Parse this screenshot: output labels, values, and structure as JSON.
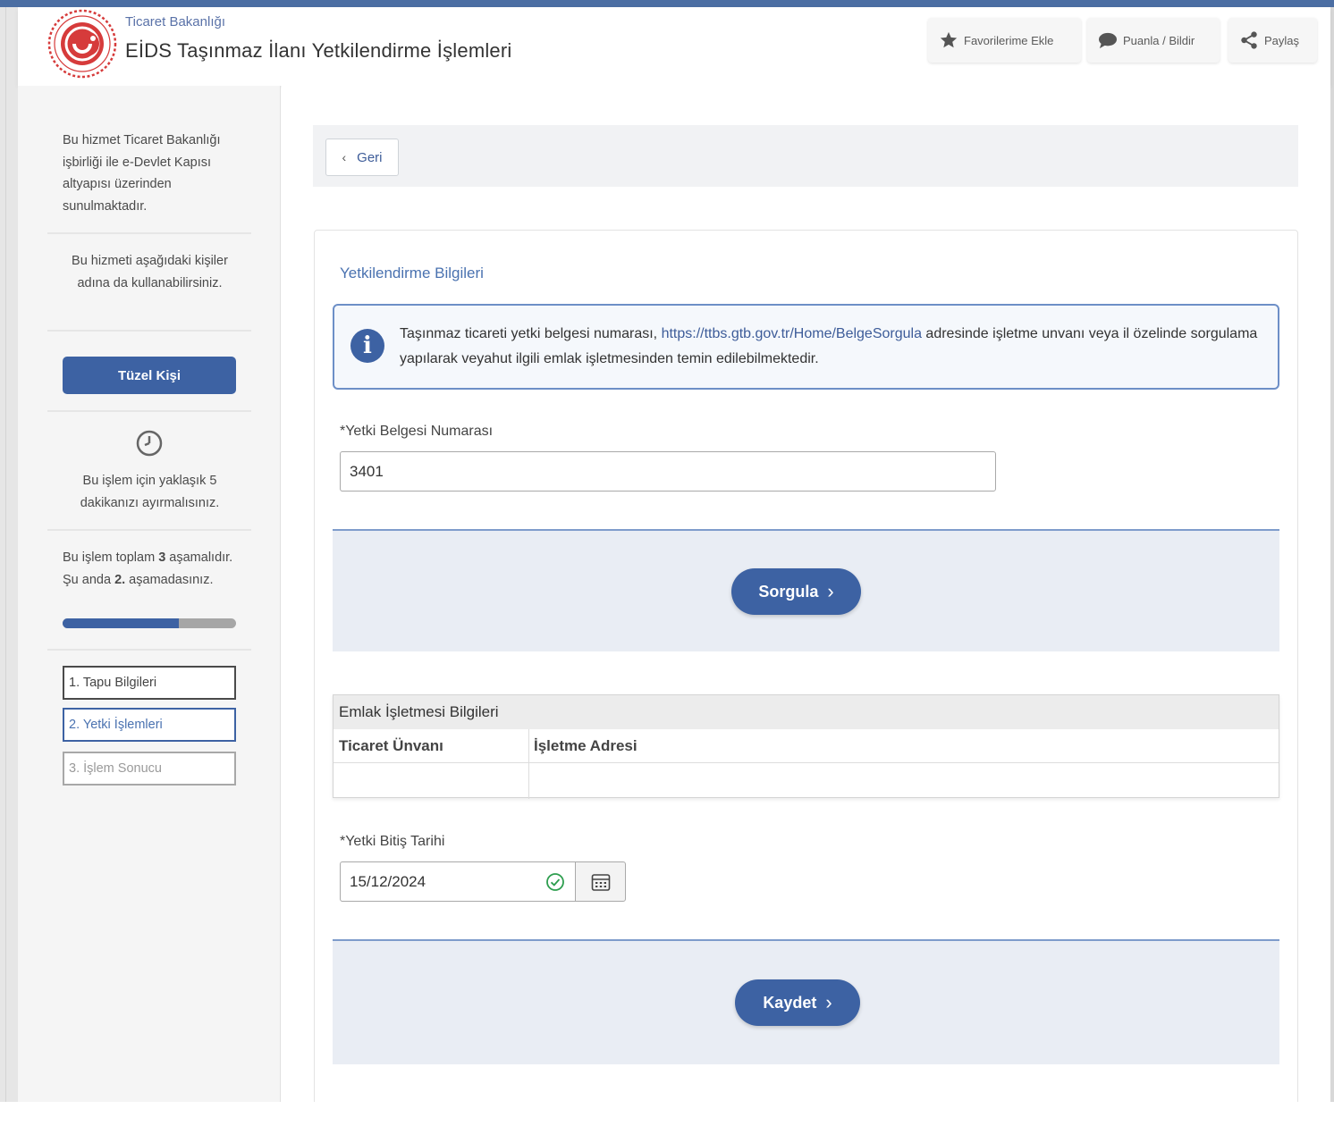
{
  "header": {
    "ministry": "Ticaret Bakanlığı",
    "title": "EİDS Taşınmaz İlanı Yetkilendirme İşlemleri",
    "favorites_label": "Favorilerime Ekle",
    "rate_label": "Puanla / Bildir",
    "share_label": "Paylaş"
  },
  "sidebar": {
    "provider_text": "Bu hizmet Ticaret Bakanlığı işbirliği ile e-Devlet Kapısı altyapısı üzerinden sunulmaktadır.",
    "proxy_text": "Bu hizmeti aşağıdaki kişiler adına da kullanabilirsiniz.",
    "tuzel_button": "Tüzel Kişi",
    "time_text": "Bu işlem için yaklaşık 5 dakikanızı ayırmalısınız.",
    "stage_prefix": "Bu işlem toplam ",
    "stage_total": "3",
    "stage_middle": " aşamalıdır. Şu anda ",
    "stage_current": "2.",
    "stage_suffix": " aşamadasınız.",
    "progress_fraction": 0.67,
    "steps": [
      {
        "label": "1. Tapu Bilgileri"
      },
      {
        "label": "2. Yetki İşlemleri"
      },
      {
        "label": "3. İşlem Sonucu"
      }
    ]
  },
  "main": {
    "back_label": "Geri",
    "section_title": "Yetkilendirme Bilgileri",
    "info_before": "Taşınmaz ticareti yetki belgesi numarası, ",
    "info_link": "https://ttbs.gtb.gov.tr/Home/BelgeSorgula",
    "info_after": " adresinde işletme unvanı veya il özelinde sorgulama yapılarak veyahut ilgili emlak işletmesinden temin edilebilmektedir.",
    "license_label": "*Yetki Belgesi Numarası",
    "license_value": "3401",
    "query_button": "Sorgula",
    "table": {
      "caption": "Emlak İşletmesi Bilgileri",
      "columns": [
        "Ticaret Ünvanı",
        "İşletme Adresi"
      ]
    },
    "end_date_label": "*Yetki Bitiş Tarihi",
    "end_date_value": "15/12/2024",
    "save_button": "Kaydet"
  },
  "colors": {
    "primary": "#3d62a3",
    "accent_link": "#4a72b0",
    "topbar": "#4b6ea3",
    "action_bg": "#e9edf4"
  },
  "icons": {
    "favorites": "star-icon",
    "rate": "speech-bubble-icon",
    "share": "share-icon",
    "time": "clock-icon",
    "info": "info-icon",
    "date_valid": "check-circle-icon",
    "calendar": "calendar-icon"
  }
}
